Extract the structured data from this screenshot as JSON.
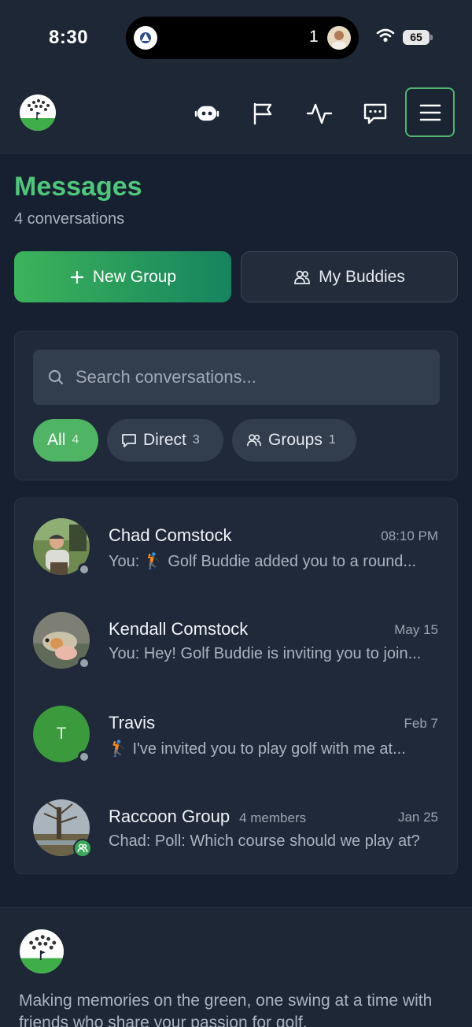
{
  "status_bar": {
    "time": "8:30",
    "live_activity_count": "1",
    "battery": "65"
  },
  "header": {
    "icons": [
      "robot-icon",
      "flag-icon",
      "activity-icon",
      "chat-icon",
      "menu-icon"
    ]
  },
  "page": {
    "title": "Messages",
    "subtitle": "4 conversations"
  },
  "actions": {
    "new_group": "New Group",
    "my_buddies": "My Buddies"
  },
  "search": {
    "placeholder": "Search conversations..."
  },
  "filters": [
    {
      "label": "All",
      "count": "4"
    },
    {
      "label": "Direct",
      "count": "3"
    },
    {
      "label": "Groups",
      "count": "1"
    }
  ],
  "conversations": [
    {
      "name": "Chad Comstock",
      "meta": "",
      "time": "08:10 PM",
      "preview": "You: 🏌 Golf Buddie added you to a round..."
    },
    {
      "name": "Kendall Comstock",
      "meta": "",
      "time": "May 15",
      "preview": "You: Hey! Golf Buddie is inviting you to join..."
    },
    {
      "name": "Travis",
      "meta": "",
      "time": "Feb 7",
      "preview": "🏌 I've invited you to play golf with me at...",
      "initial": "T"
    },
    {
      "name": "Raccoon Group",
      "meta": "4 members",
      "time": "Jan 25",
      "preview": "Chad: Poll: Which course should we play at?"
    }
  ],
  "footer": {
    "tagline": "Making memories on the green, one swing at a time with friends who share your passion for golf."
  },
  "colors": {
    "accent_green": "#4ec77b",
    "background": "#172030",
    "card": "#1f2939"
  }
}
